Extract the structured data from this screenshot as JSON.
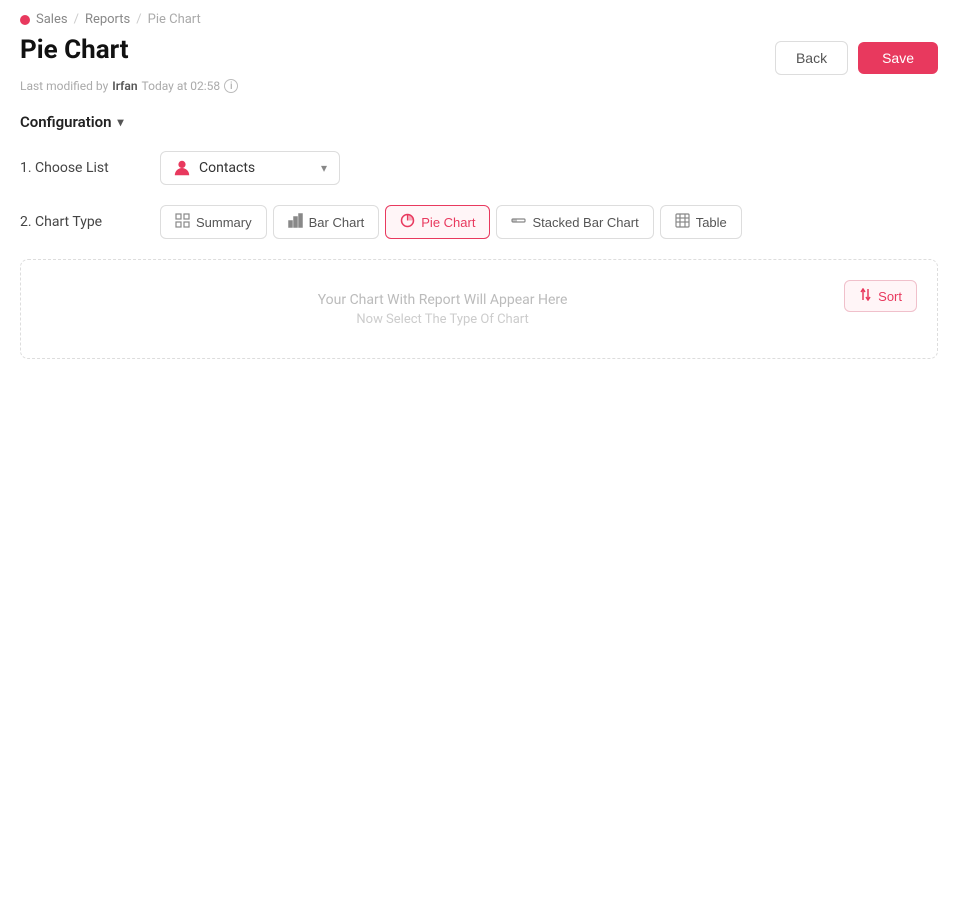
{
  "breadcrumb": {
    "part1": "Sales",
    "part2": "Reports",
    "part3": "Pie Chart"
  },
  "header": {
    "title": "Pie Chart",
    "meta": "Last modified by",
    "user": "Irfan",
    "time": "Today at 02:58",
    "back_label": "Back",
    "save_label": "Save"
  },
  "config": {
    "label": "Configuration",
    "step1_label": "1. Choose List",
    "step1_value": "Contacts",
    "step2_label": "2. Chart Type",
    "chart_types": [
      {
        "key": "summary",
        "label": "Summary",
        "icon": "⊞"
      },
      {
        "key": "bar",
        "label": "Bar Chart",
        "icon": "📊"
      },
      {
        "key": "pie",
        "label": "Pie Chart",
        "icon": "◑",
        "active": true
      },
      {
        "key": "stacked",
        "label": "Stacked Bar Chart",
        "icon": "▭"
      },
      {
        "key": "table",
        "label": "Table",
        "icon": "⊟"
      }
    ]
  },
  "chart_area": {
    "placeholder_title": "Your Chart With Report Will Appear Here",
    "placeholder_sub": "Now Select The Type Of Chart",
    "sort_label": "Sort"
  }
}
